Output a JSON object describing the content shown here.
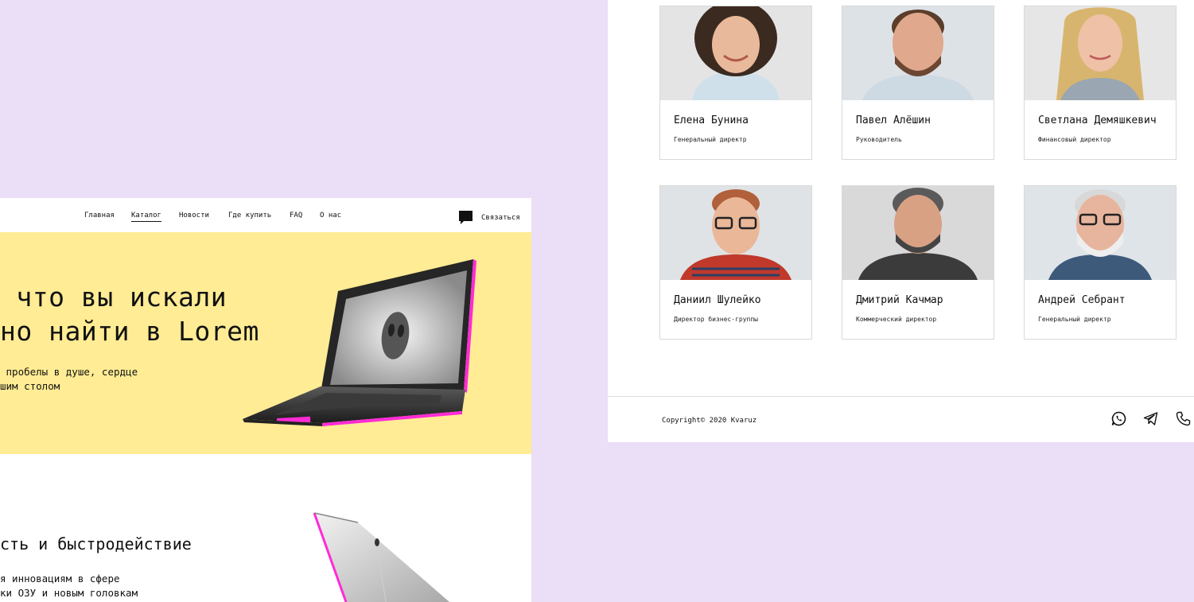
{
  "nav": {
    "items": [
      {
        "label": "Главная"
      },
      {
        "label": "Каталог",
        "active": true
      },
      {
        "label": "Новости"
      },
      {
        "label": "Где купить"
      },
      {
        "label": "FAQ"
      },
      {
        "label": "О нас"
      }
    ],
    "contact_label": "Связаться"
  },
  "hero": {
    "title": " что вы искали\nно найти в Lorem",
    "subtitle": " пробелы в душе, сердце\nшим столом"
  },
  "section2": {
    "title": "сть и быстродействие",
    "text": "я инновациям в сфере\nки ОЗУ и новым головкам"
  },
  "team": [
    {
      "name": "Елена Бунина",
      "role": "Генеральный директр"
    },
    {
      "name": "Павел Алёшин",
      "role": "Руководитель"
    },
    {
      "name": "Светлана Демяшкевич",
      "role": "Финансовый директор"
    },
    {
      "name": "Даниил Шулейко",
      "role": "Директор бизнес-группы"
    },
    {
      "name": "Дмитрий Качмар",
      "role": "Коммерческий директор"
    },
    {
      "name": "Андрей Себрант",
      "role": "Генеральный директр"
    }
  ],
  "footer": {
    "copyright": "Copyright© 2020 Kvaruz"
  },
  "colors": {
    "page_bg": "#ebdef7",
    "hero_bg": "#ffec94",
    "accent_pink": "#ff2bd6"
  },
  "icons": [
    "chat-bubble-icon",
    "whatsapp-icon",
    "telegram-icon",
    "phone-icon"
  ]
}
